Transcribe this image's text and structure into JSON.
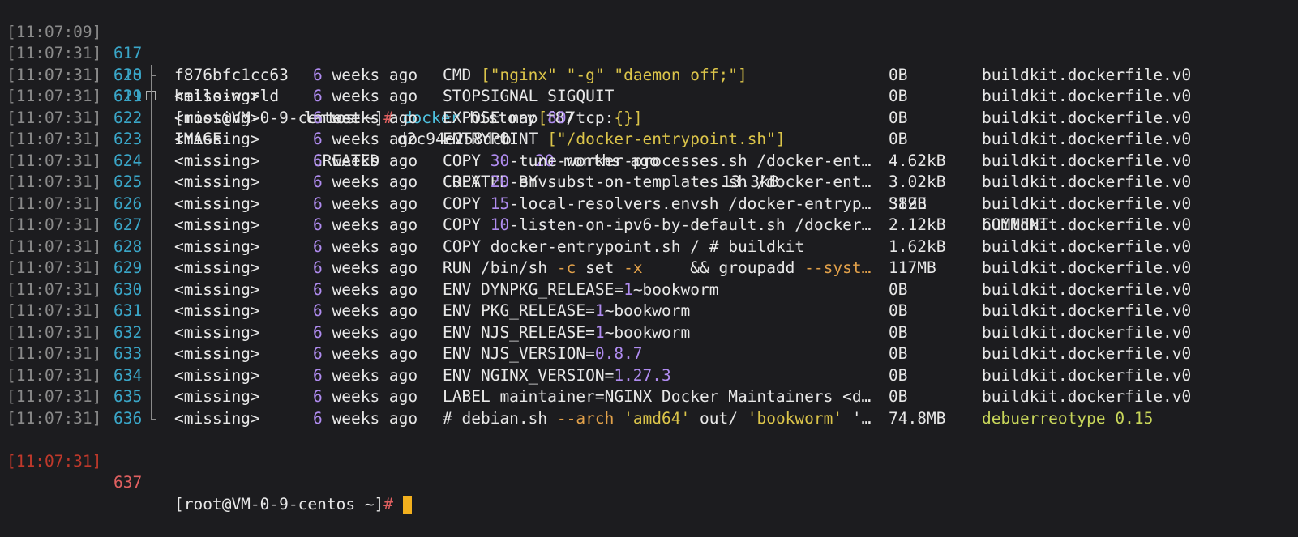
{
  "terminal": {
    "images_row": {
      "timestamp": "[11:07:09]",
      "line": "617",
      "repository": "hello-world",
      "tag": "latest",
      "image_id": "d2c94e258dcb",
      "created_num": "20",
      "created_rest": " months ago",
      "size": "13.3kB"
    },
    "command_row": {
      "timestamp": "[11:07:31]",
      "line": "618",
      "prompt": "[root@VM-0-9-centos ~]",
      "prompt_symbol": "#",
      "command": " docker",
      "args": " history f87"
    },
    "header_row": {
      "timestamp": "[11:07:31]",
      "line": "619",
      "image": "IMAGE",
      "created": "CREATED",
      "created_by": "CREATED BY",
      "size": "SIZE",
      "comment": "COMMENT"
    },
    "history_rows": [
      {
        "timestamp": "[11:07:31]",
        "line": "620",
        "image": "f876bfc1cc63",
        "created_num": "6",
        "created_rest": " weeks ago",
        "created_by": "CMD [\"nginx\" \"-g\" \"daemon off;\"]",
        "size": "0B",
        "comment": "buildkit.dockerfile.v0"
      },
      {
        "timestamp": "[11:07:31]",
        "line": "621",
        "image": "<missing>",
        "created_num": "6",
        "created_rest": " weeks ago",
        "created_by": "STOPSIGNAL SIGQUIT",
        "size": "0B",
        "comment": "buildkit.dockerfile.v0"
      },
      {
        "timestamp": "[11:07:31]",
        "line": "622",
        "image": "<missing>",
        "created_num": "6",
        "created_rest": " weeks ago",
        "created_by": "EXPOSE map[80/tcp:{}]",
        "size": "0B",
        "comment": "buildkit.dockerfile.v0"
      },
      {
        "timestamp": "[11:07:31]",
        "line": "623",
        "image": "<missing>",
        "created_num": "6",
        "created_rest": " weeks ago",
        "created_by": "ENTRYPOINT [\"/docker-entrypoint.sh\"]",
        "size": "0B",
        "comment": "buildkit.dockerfile.v0"
      },
      {
        "timestamp": "[11:07:31]",
        "line": "624",
        "image": "<missing>",
        "created_num": "6",
        "created_rest": " weeks ago",
        "created_by": "COPY 30-tune-worker-processes.sh /docker-ent…",
        "size": "4.62kB",
        "comment": "buildkit.dockerfile.v0"
      },
      {
        "timestamp": "[11:07:31]",
        "line": "625",
        "image": "<missing>",
        "created_num": "6",
        "created_rest": " weeks ago",
        "created_by": "COPY 20-envsubst-on-templates.sh /docker-ent…",
        "size": "3.02kB",
        "comment": "buildkit.dockerfile.v0"
      },
      {
        "timestamp": "[11:07:31]",
        "line": "626",
        "image": "<missing>",
        "created_num": "6",
        "created_rest": " weeks ago",
        "created_by": "COPY 15-local-resolvers.envsh /docker-entryp…",
        "size": "389B",
        "comment": "buildkit.dockerfile.v0"
      },
      {
        "timestamp": "[11:07:31]",
        "line": "627",
        "image": "<missing>",
        "created_num": "6",
        "created_rest": " weeks ago",
        "created_by": "COPY 10-listen-on-ipv6-by-default.sh /docker…",
        "size": "2.12kB",
        "comment": "buildkit.dockerfile.v0"
      },
      {
        "timestamp": "[11:07:31]",
        "line": "628",
        "image": "<missing>",
        "created_num": "6",
        "created_rest": " weeks ago",
        "created_by": "COPY docker-entrypoint.sh / # buildkit",
        "size": "1.62kB",
        "comment": "buildkit.dockerfile.v0"
      },
      {
        "timestamp": "[11:07:31]",
        "line": "629",
        "image": "<missing>",
        "created_num": "6",
        "created_rest": " weeks ago",
        "created_by": "RUN /bin/sh -c set -x     && groupadd --syst…",
        "size": "117MB",
        "comment": "buildkit.dockerfile.v0"
      },
      {
        "timestamp": "[11:07:31]",
        "line": "630",
        "image": "<missing>",
        "created_num": "6",
        "created_rest": " weeks ago",
        "created_by": "ENV DYNPKG_RELEASE=1~bookworm",
        "size": "0B",
        "comment": "buildkit.dockerfile.v0"
      },
      {
        "timestamp": "[11:07:31]",
        "line": "631",
        "image": "<missing>",
        "created_num": "6",
        "created_rest": " weeks ago",
        "created_by": "ENV PKG_RELEASE=1~bookworm",
        "size": "0B",
        "comment": "buildkit.dockerfile.v0"
      },
      {
        "timestamp": "[11:07:31]",
        "line": "632",
        "image": "<missing>",
        "created_num": "6",
        "created_rest": " weeks ago",
        "created_by": "ENV NJS_RELEASE=1~bookworm",
        "size": "0B",
        "comment": "buildkit.dockerfile.v0"
      },
      {
        "timestamp": "[11:07:31]",
        "line": "633",
        "image": "<missing>",
        "created_num": "6",
        "created_rest": " weeks ago",
        "created_by": "ENV NJS_VERSION=0.8.7",
        "size": "0B",
        "comment": "buildkit.dockerfile.v0"
      },
      {
        "timestamp": "[11:07:31]",
        "line": "634",
        "image": "<missing>",
        "created_num": "6",
        "created_rest": " weeks ago",
        "created_by": "ENV NGINX_VERSION=1.27.3",
        "size": "0B",
        "comment": "buildkit.dockerfile.v0"
      },
      {
        "timestamp": "[11:07:31]",
        "line": "635",
        "image": "<missing>",
        "created_num": "6",
        "created_rest": " weeks ago",
        "created_by": "LABEL maintainer=NGINX Docker Maintainers <d…",
        "size": "0B",
        "comment": "buildkit.dockerfile.v0"
      },
      {
        "timestamp": "[11:07:31]",
        "line": "636",
        "image": "<missing>",
        "created_num": "6",
        "created_rest": " weeks ago",
        "created_by": "# debian.sh --arch 'amd64' out/ 'bookworm' '…",
        "size": "74.8MB",
        "comment": "debuerreotype 0.15"
      }
    ],
    "prompt_row": {
      "timestamp": "[11:07:31]",
      "line": "637",
      "prompt": "[root@VM-0-9-centos ~]",
      "prompt_symbol": "#"
    },
    "colors": {
      "background": "#1c1c1f",
      "timestamp": "#8a8a8a",
      "line_number": "#3aa6c8",
      "number_highlight": "#b08cf0",
      "command": "#4ec2e0",
      "prompt_symbol": "#e06060",
      "string_literal": "#dcc54a",
      "flag": "#e2a14a",
      "cursor": "#f2b01e"
    }
  }
}
